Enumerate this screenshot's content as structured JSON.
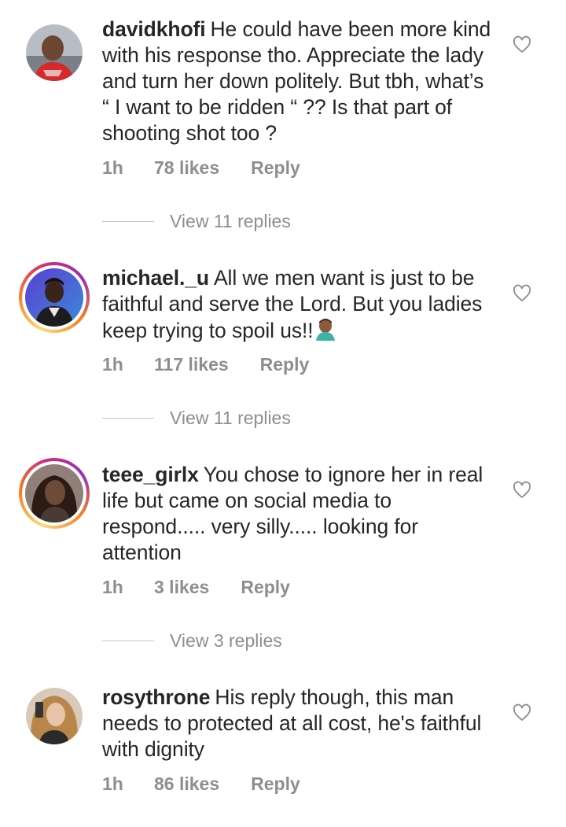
{
  "comments": [
    {
      "username": "davidkhofi",
      "text": "He could have been more kind with his response tho. Appreciate the lady and turn her down politely. But tbh, what’s “ I want to be ridden “ ?? Is that part of shooting shot too ?",
      "time": "1h",
      "likes": "78 likes",
      "reply": "Reply",
      "view_replies": "View 11 replies",
      "has_story_ring": false,
      "avatar_icon": "avatar-photo-man-car"
    },
    {
      "username": "michael._u",
      "text": "All we men want is just to be faithful and serve the Lord. But you ladies keep trying to spoil us!!",
      "emoji": "man-facepalming-emoji",
      "time": "1h",
      "likes": "117 likes",
      "reply": "Reply",
      "view_replies": "View 11 replies",
      "has_story_ring": true,
      "avatar_icon": "avatar-photo-man-purple"
    },
    {
      "username": "teee_girlx",
      "text": "You chose to ignore her in real life but came on social media to respond..... very silly..... looking for attention",
      "time": "1h",
      "likes": "3 likes",
      "reply": "Reply",
      "view_replies": "View 3 replies",
      "has_story_ring": true,
      "avatar_icon": "avatar-photo-woman"
    },
    {
      "username": "rosythrone",
      "text": "His reply though, this man needs to protected at all cost, he's faithful with dignity",
      "time": "1h",
      "likes": "86 likes",
      "reply": "Reply",
      "has_story_ring": false,
      "avatar_icon": "avatar-photo-woman-selfie"
    }
  ],
  "colors": {
    "text": "#262626",
    "muted": "#8e8e8e",
    "divider": "#c7c7c7"
  }
}
